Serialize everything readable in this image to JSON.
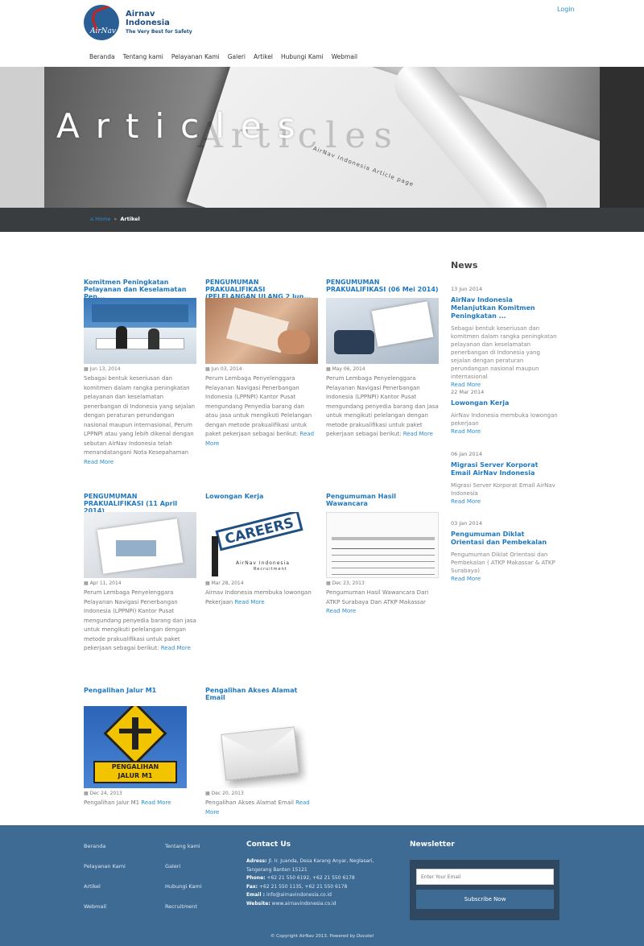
{
  "brand": {
    "line1": "Airnav",
    "line2": "Indonesia",
    "tagline": "The Very Best for Safety",
    "mark": "AirNav"
  },
  "login": "Login",
  "nav": [
    "Beranda",
    "Tentang kami",
    "Pelayanan Kami",
    "Galeri",
    "Artikel",
    "Hubungi Kami",
    "Webmail"
  ],
  "hero": {
    "title": "Articles",
    "ghost": "Articles",
    "subtitle": "AirNav Indonesia Article page"
  },
  "breadcrumb": {
    "home": "Home",
    "sep": "»",
    "current": "Artikel"
  },
  "articles": [
    {
      "title": "Komitmen Peningkatan Pelayanan dan Keselamatan Pen...",
      "date": "Jun 13, 2014",
      "excerpt": "Sebagai bentuk keseriusan dan komitmen dalam rangka peningkatan pelayanan dan keselamatan penerbangan di Indonesia yang sejalan dengan peraturan perundangan nasional maupun internasional, Perum LPPNPI atau yang lebih dikenal dengan sebutan AirNav Indonesia telah menandatangani Nota Kesepahaman",
      "more": "Read More"
    },
    {
      "title": "PENGUMUMAN PRAKUALIFIKASI (PELELANGAN ULANG 2 Jun...",
      "date": "Jun 03, 2014",
      "excerpt": "Perum Lembaga Penyelenggara Pelayanan Navigasi Penerbangan Indonesia (LPPNPI) Kantor Pusat mengundang Penyedia barang dan atau jasa untuk mengikuti Pelelangan dengan metode prakualifikasi untuk paket pekerjaan sebagai berikut:",
      "more": "Read More"
    },
    {
      "title": "PENGUMUMAN PRAKUALIFIKASI (06 Mei 2014)",
      "date": "May 06, 2014",
      "excerpt": "Perum Lembaga Penyelenggara Pelayanan Navigasi Penerbangan Indonesia (LPPNPI) Kantor Pusat mengundang penyedia barang dan jasa untuk mengikuti pelelangan dengan metode prakualifikasi untuk paket pekerjaan sebagai berikut:",
      "more": "Read More"
    },
    {
      "title": "PENGUMUMAN PRAKUALIFIKASI (11 April 2014)",
      "date": "Apr 11, 2014",
      "excerpt": "Perum Lembaga Penyelenggara Pelayanan Navigasi Penerbangan Indonesia (LPPNPI) Kantor Pusat mengundang penyedia barang dan jasa untuk mengikuti pelelangan dengan metode prakualifikasi untuk paket pekerjaan sebagai berikut:",
      "more": "Read More"
    },
    {
      "title": "Lowongan Kerja",
      "date": "Mar 28, 2014",
      "excerpt": "Airnav Indonesia membuka lowongan Pekerjaan",
      "more": "Read More",
      "img_text": "CAREERS",
      "img_sub1": "AirNav Indonesia",
      "img_sub2": "Recruitment"
    },
    {
      "title": "Pengumuman Hasil Wawancara",
      "date": "Dec 23, 2013",
      "excerpt": "Pengumuman Hasil Wawancara Dari ATKP Surabaya Dan ATKP Makassar",
      "more": "Read More"
    },
    {
      "title": "Pengalihan Jalur M1",
      "date": "Dec 24, 2013",
      "excerpt": "Pengalihan Jalur M1",
      "more": "Read More",
      "img_text1": "PENGALIHAN",
      "img_text2": "JALUR M1"
    },
    {
      "title": "Pengalihan Akses Alamat Email",
      "date": "Dec 20, 2013",
      "excerpt": "Pengalihan Akses Alamat Email",
      "more": "Read More"
    }
  ],
  "news": {
    "heading": "News",
    "items": [
      {
        "date": "13 Jun 2014",
        "title": "AirNav Indonesia Melanjutkan Komitmen Peningkatan ...",
        "excerpt": "Sebagai bentuk keseriusan dan komitmen dalam rangka peningkatan pelayanan dan keselamatan penerbangan di Indonesia yang sejalan dengan peraturan perundangan nasional maupun internasional",
        "more": "Read More"
      },
      {
        "date": "22 Mar 2014",
        "title": "Lowongan Kerja",
        "excerpt": "AirNav Indonesia membuka lowongan pekerjaan",
        "more": "Read More"
      },
      {
        "date": "06 Jan 2014",
        "title": "Migrasi Server Korporat Email AirNav Indonesia",
        "excerpt": "Migrasi Server Korporat Email AirNav Indonesia",
        "more": "Read More"
      },
      {
        "date": "03 Jan 2014",
        "title": "Pengumuman Diklat Orientasi dan Pembekalan",
        "excerpt": "Pengumuman Diklat Orientasi dan Pembekalan ( ATKP Makassar & ATKP Surabaya)",
        "more": "Read More"
      }
    ]
  },
  "footer": {
    "links": [
      "Beranda",
      "Tentang kami",
      "Pelayanan Kami",
      "Galeri",
      "Artikel",
      "Hubungi Kami",
      "Webmail",
      "Recruitment"
    ],
    "contact_title": "Contact Us",
    "address_label": "Adress:",
    "address": "Jl. Ir. Juanda, Desa Karang Anyar, Neglasari, Tangerang Banten 15121",
    "phone_label": "Phone:",
    "phone": "+62 21 550 6192, +62 21 550 6178",
    "fax_label": "Fax:",
    "fax": "+62 21 550 1135, +62 21 550 6178",
    "email_label": "Email :",
    "email": "info@airnavindonesia.co.id",
    "website_label": "Website:",
    "website": "www.airnavindonesia.co.id",
    "newsletter_title": "Newsletter",
    "newsletter_placeholder": "Enter Your Email",
    "subscribe": "Subscribe Now",
    "copyright": "© Copyright AirNav 2013. Powered by",
    "powered": "Docotel"
  }
}
